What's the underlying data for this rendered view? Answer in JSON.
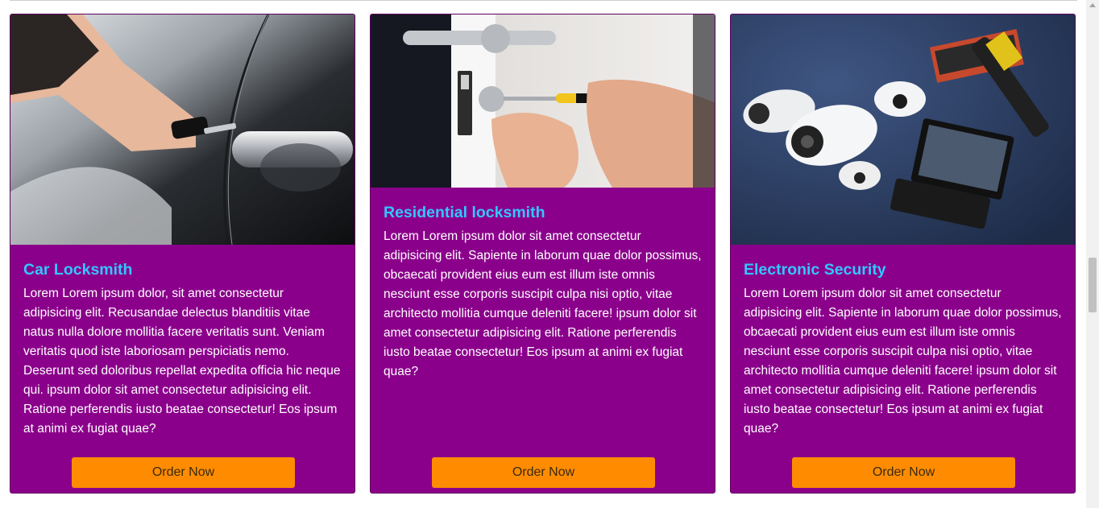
{
  "cards": [
    {
      "title": "Car Locksmith",
      "text": "Lorem Lorem ipsum dolor, sit amet consectetur adipisicing elit. Recusandae delectus blanditiis vitae natus nulla dolore mollitia facere veritatis sunt. Veniam veritatis quod iste laboriosam perspiciatis nemo. Deserunt sed doloribus repellat expedita officia hic neque qui. ipsum dolor sit amet consectetur adipisicing elit. Ratione perferendis iusto beatae consectetur! Eos ipsum at animi ex fugiat quae?",
      "button": "Order Now",
      "image": "car-door-key-photo"
    },
    {
      "title": "Residential locksmith",
      "text": "Lorem Lorem ipsum dolor sit amet consectetur adipisicing elit. Sapiente in laborum quae dolor possimus, obcaecati provident eius eum est illum iste omnis nesciunt esse corporis suscipit culpa nisi optio, vitae architecto mollitia cumque deleniti facere! ipsum dolor sit amet consectetur adipisicing elit. Ratione perferendis iusto beatae consectetur! Eos ipsum at animi ex fugiat quae?",
      "button": "Order Now",
      "image": "door-lock-screwdriver-photo"
    },
    {
      "title": "Electronic Security",
      "text": "Lorem Lorem ipsum dolor sit amet consectetur adipisicing elit. Sapiente in laborum quae dolor possimus, obcaecati provident eius eum est illum iste omnis nesciunt esse corporis suscipit culpa nisi optio, vitae architecto mollitia cumque deleniti facere! ipsum dolor sit amet consectetur adipisicing elit. Ratione perferendis iusto beatae consectetur! Eos ipsum at animi ex fugiat quae?",
      "button": "Order Now",
      "image": "security-cameras-photo"
    }
  ],
  "colors": {
    "card_background": "#8b008b",
    "title": "#34c6ff",
    "button": "#ff8c00"
  }
}
